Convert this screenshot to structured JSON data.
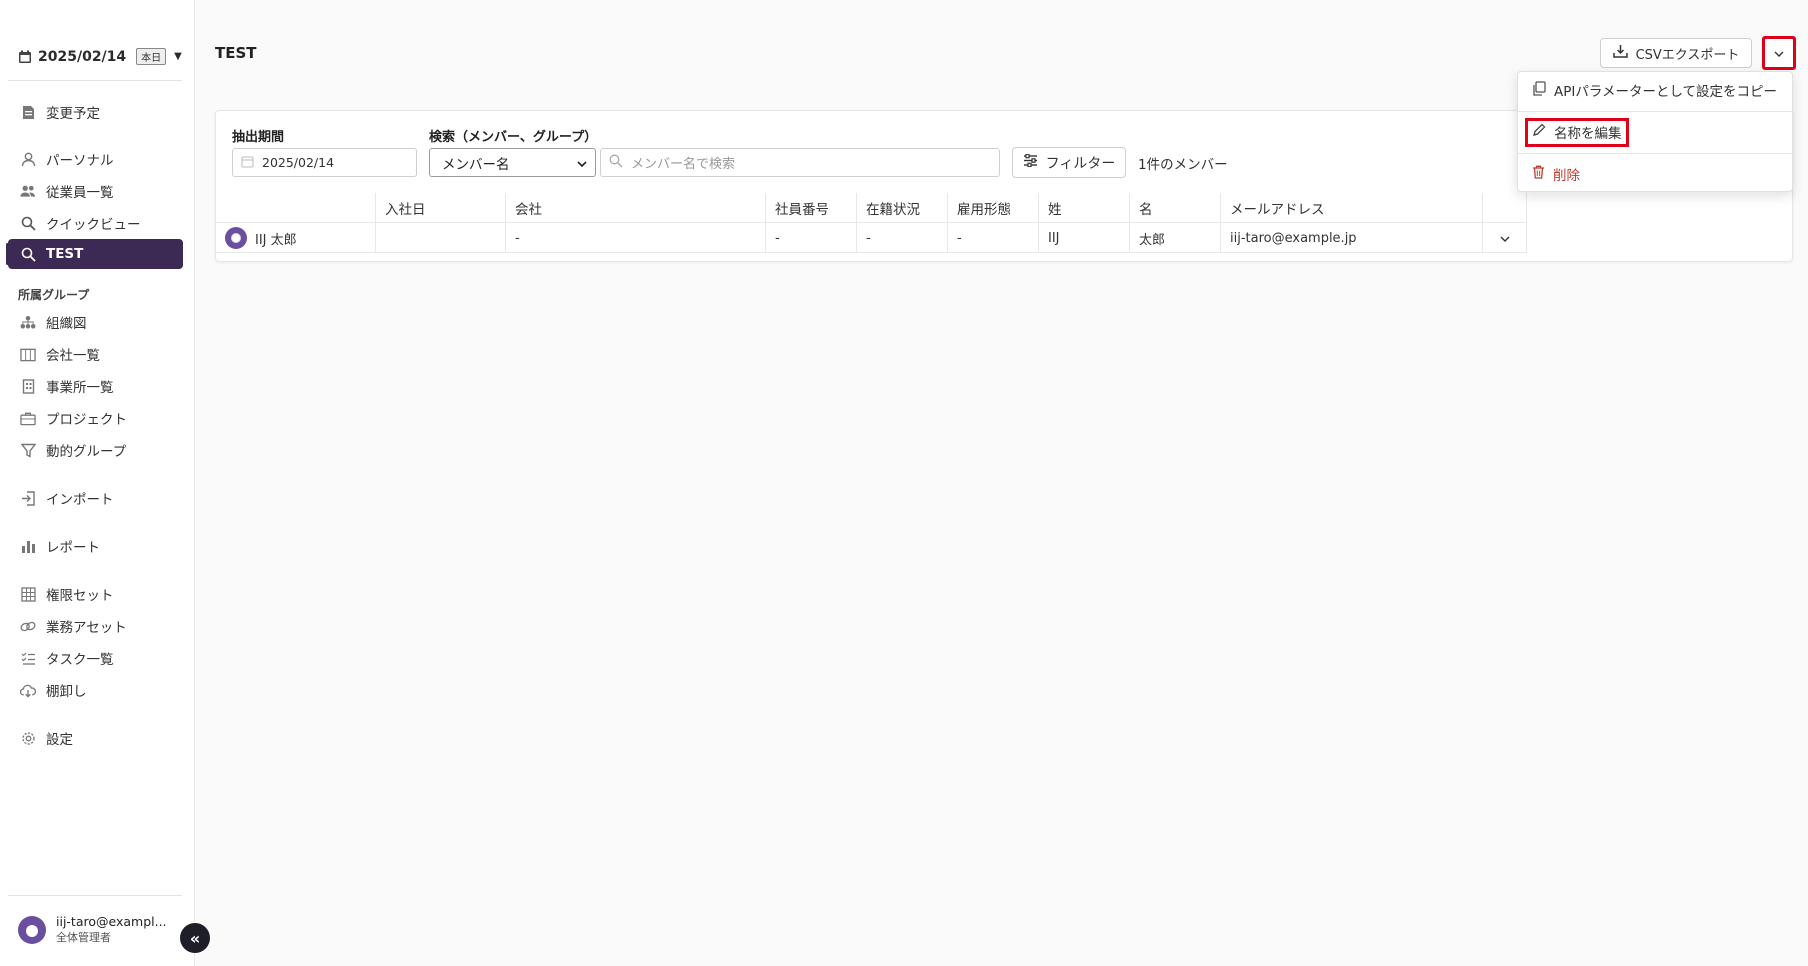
{
  "sidebar": {
    "date": "2025/02/14",
    "today_badge": "本日",
    "items": [
      {
        "label": "変更予定",
        "icon": "document-icon"
      },
      {
        "label": "パーソナル",
        "icon": "person-icon"
      },
      {
        "label": "従業員一覧",
        "icon": "people-icon"
      },
      {
        "label": "クイックビュー",
        "icon": "search-icon"
      },
      {
        "label": "TEST",
        "icon": "search-icon",
        "active": true
      },
      {
        "label": "組織図",
        "icon": "org-chart-icon"
      },
      {
        "label": "会社一覧",
        "icon": "company-icon"
      },
      {
        "label": "事業所一覧",
        "icon": "building-icon"
      },
      {
        "label": "プロジェクト",
        "icon": "briefcase-icon"
      },
      {
        "label": "動的グループ",
        "icon": "funnel-icon"
      },
      {
        "label": "インポート",
        "icon": "import-icon"
      },
      {
        "label": "レポート",
        "icon": "bar-chart-icon"
      },
      {
        "label": "権限セット",
        "icon": "grid-icon"
      },
      {
        "label": "業務アセット",
        "icon": "link-icon"
      },
      {
        "label": "タスク一覧",
        "icon": "task-list-icon"
      },
      {
        "label": "棚卸し",
        "icon": "cloud-download-icon"
      },
      {
        "label": "設定",
        "icon": "gear-icon"
      }
    ],
    "section_label": "所属グループ",
    "user": {
      "email": "iij-taro@exampl...",
      "role": "全体管理者"
    }
  },
  "header": {
    "title": "TEST",
    "csv_export_label": "CSVエクスポート"
  },
  "menu": {
    "items": [
      {
        "label": "APIパラメーターとして設定をコピー",
        "icon": "copy-icon"
      },
      {
        "label": "名称を編集",
        "icon": "pencil-icon"
      },
      {
        "label": "削除",
        "icon": "trash-icon"
      }
    ]
  },
  "filters": {
    "period_label": "抽出期間",
    "period_value": "2025/02/14",
    "search_label": "検索（メンバー、グループ）",
    "search_type_value": "メンバー名",
    "search_placeholder": "メンバー名で検索",
    "filter_button": "フィルター",
    "member_count": "1件のメンバー"
  },
  "table": {
    "columns": [
      "",
      "入社日",
      "会社",
      "社員番号",
      "在籍状況",
      "雇用形態",
      "姓",
      "名",
      "メールアドレス",
      ""
    ],
    "rows": [
      {
        "name": "IIJ 太郎",
        "join_date": "",
        "company": "-",
        "employee_no": "-",
        "status": "-",
        "employment": "-",
        "last_name": "IIJ",
        "first_name": "太郎",
        "email": "iij-taro@example.jp"
      }
    ]
  },
  "colors": {
    "active": "#3c2a55",
    "highlight": "#e0001a",
    "danger": "#c0392b",
    "avatar": "#6a4fa0"
  }
}
